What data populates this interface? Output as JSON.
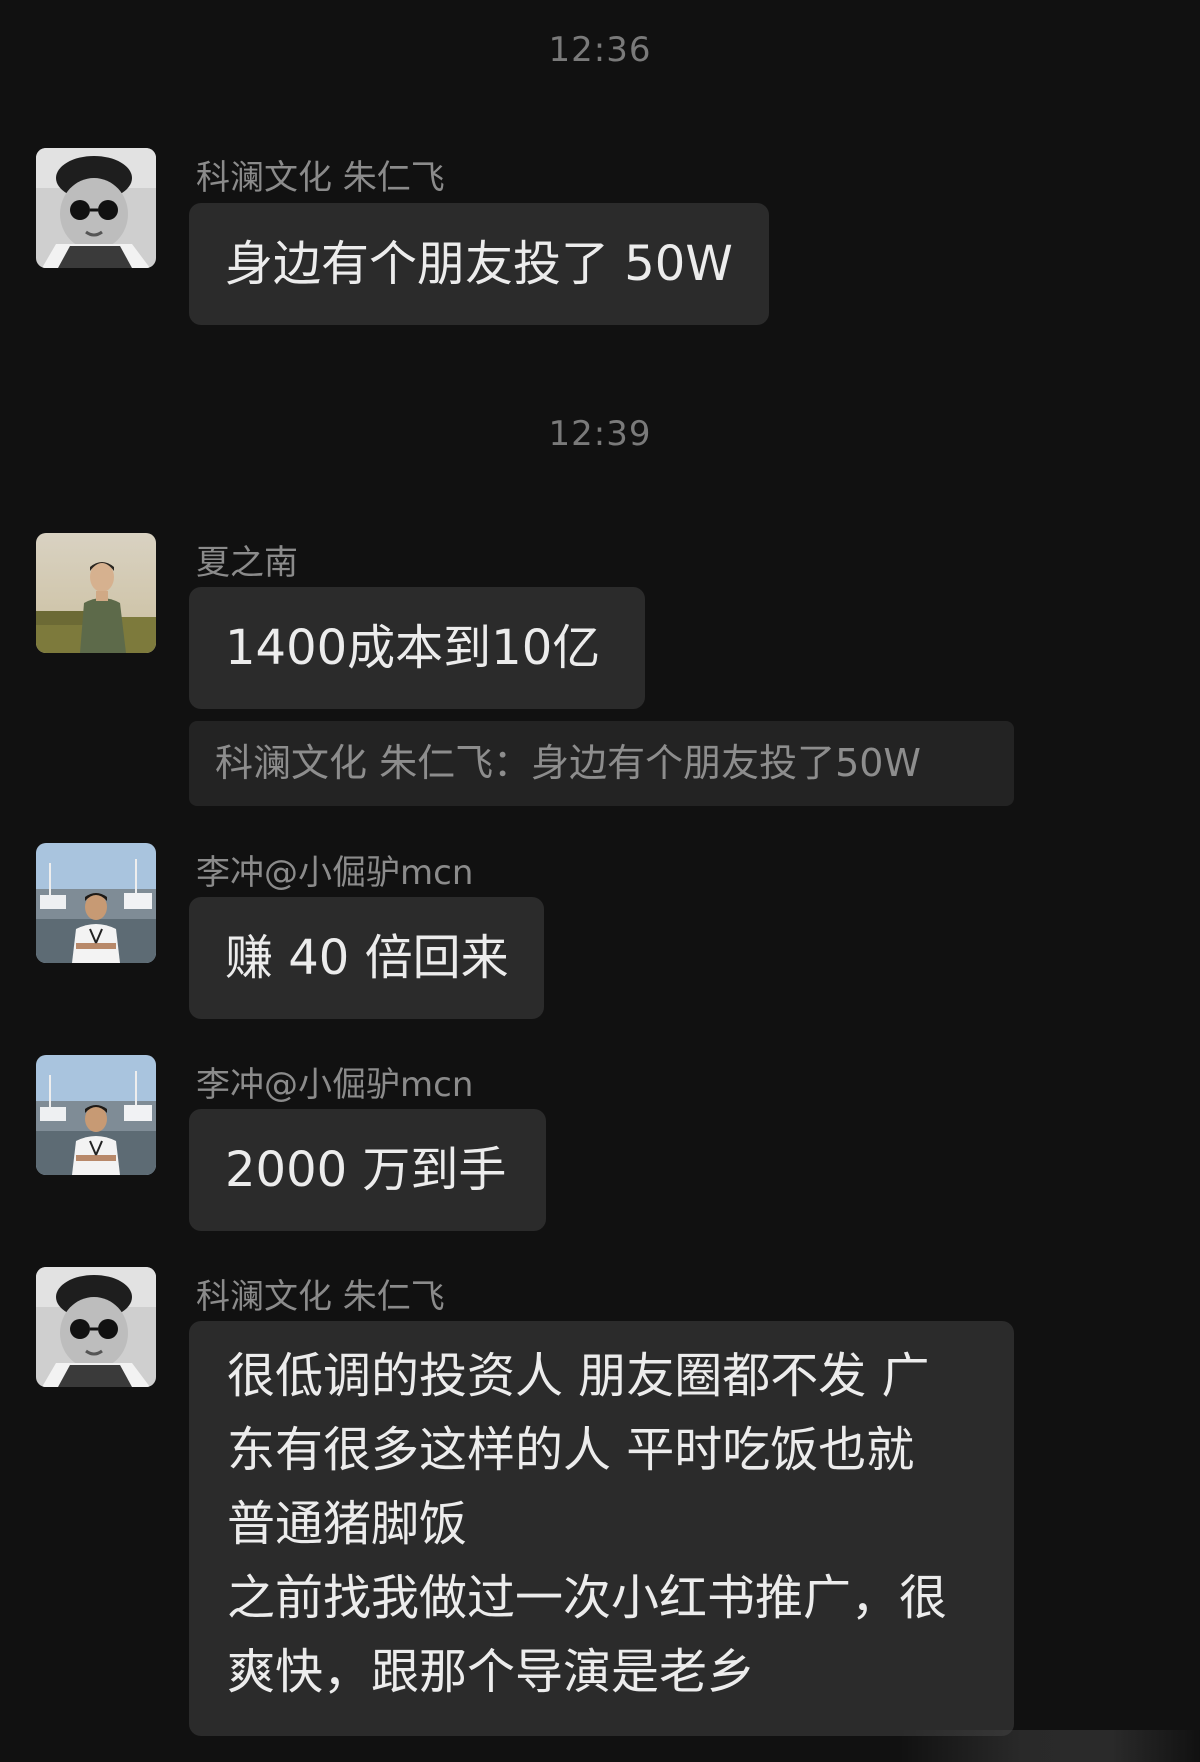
{
  "timestamps": [
    "12:36",
    "12:39"
  ],
  "messages": [
    {
      "sender": "科澜文化 朱仁飞",
      "avatar": "bw-kid-sunglasses-avatar",
      "text": "身边有个朋友投了 50W"
    },
    {
      "sender": "夏之南",
      "avatar": "man-in-field-avatar",
      "text": "1400成本到10亿",
      "quote": "科澜文化 朱仁飞：身边有个朋友投了50W"
    },
    {
      "sender": "李冲@小倔驴mcn",
      "avatar": "man-at-marina-avatar",
      "text": "赚 40 倍回来"
    },
    {
      "sender": "李冲@小倔驴mcn",
      "avatar": "man-at-marina-avatar",
      "text": "2000 万到手"
    },
    {
      "sender": "科澜文化 朱仁飞",
      "avatar": "bw-kid-sunglasses-avatar",
      "lines": [
        "很低调的投资人 朋友圈都不发 广",
        "东有很多这样的人 平时吃饭也就",
        "普通猪脚饭",
        "之前找我做过一次小红书推广，很",
        "爽快，跟那个导演是老乡"
      ]
    }
  ]
}
